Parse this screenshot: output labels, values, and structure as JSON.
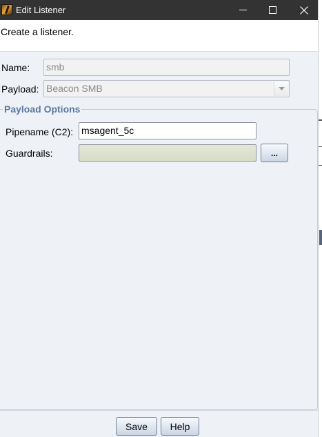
{
  "window": {
    "title": "Edit Listener"
  },
  "header": {
    "text": "Create a listener."
  },
  "form": {
    "name_label": "Name:",
    "name_value": "smb",
    "payload_label": "Payload:",
    "payload_value": "Beacon SMB"
  },
  "payload_options": {
    "title": "Payload Options",
    "pipename_label": "Pipename (C2):",
    "pipename_value": "msagent_5c",
    "guardrails_label": "Guardrails:",
    "guardrails_value": "",
    "browse_label": "..."
  },
  "footer": {
    "save_label": "Save",
    "help_label": "Help"
  },
  "icons": {
    "app": "cobalt-strike-app-icon",
    "minimize": "minimize-icon",
    "maximize": "maximize-icon",
    "close": "close-icon",
    "dropdown": "chevron-down-icon"
  }
}
